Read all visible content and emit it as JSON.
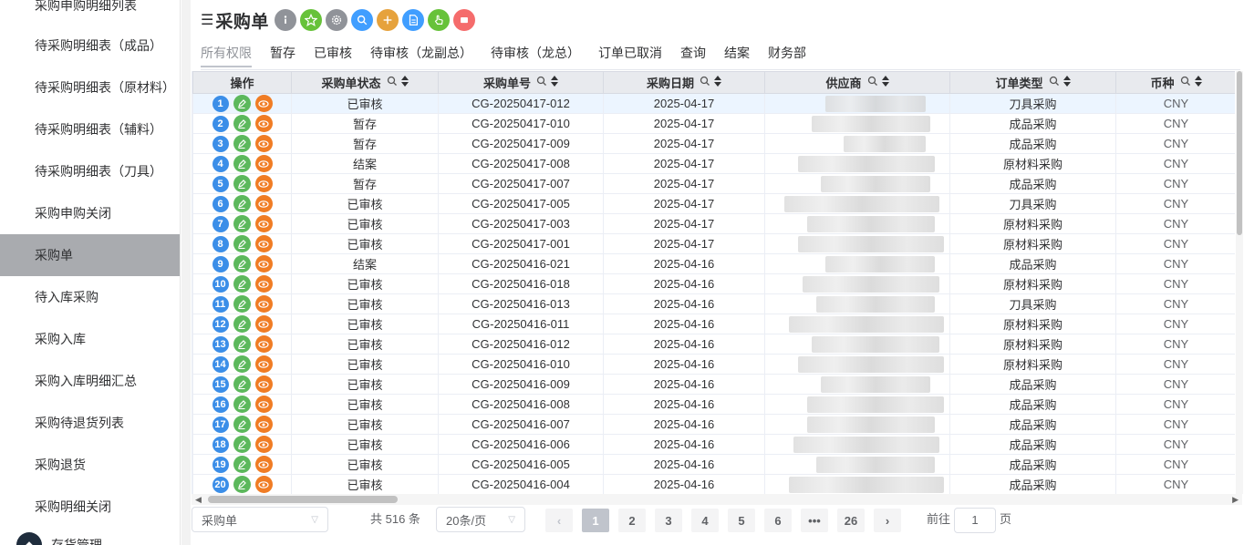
{
  "sidebar": {
    "items": [
      {
        "label": "采购申购明细列表"
      },
      {
        "label": "待采购明细表（成品）"
      },
      {
        "label": "待采购明细表（原材料）"
      },
      {
        "label": "待采购明细表（辅料）"
      },
      {
        "label": "待采购明细表（刀具）"
      },
      {
        "label": "采购申购关闭"
      },
      {
        "label": "采购单"
      },
      {
        "label": "待入库采购"
      },
      {
        "label": "采购入库"
      },
      {
        "label": "采购入库明细汇总"
      },
      {
        "label": "采购待退货列表"
      },
      {
        "label": "采购退货"
      },
      {
        "label": "采购明细关闭"
      }
    ],
    "active_index": 6,
    "bottom_group": {
      "label": "存货管理"
    }
  },
  "header": {
    "title": "采购单",
    "menu_icon": "☰",
    "toolbar": [
      {
        "icon": "info-icon",
        "color": "#909399"
      },
      {
        "icon": "star-icon",
        "color": "#67c23a"
      },
      {
        "icon": "settings-icon",
        "color": "#909399"
      },
      {
        "icon": "search-icon",
        "color": "#409eff"
      },
      {
        "icon": "plus-icon",
        "color": "#e6a23c"
      },
      {
        "icon": "document-icon",
        "color": "#409eff"
      },
      {
        "icon": "hand-icon",
        "color": "#67c23a"
      },
      {
        "icon": "delete-icon",
        "color": "#f56c6c"
      }
    ]
  },
  "tabs": [
    {
      "label": "所有权限"
    },
    {
      "label": "暂存"
    },
    {
      "label": "已审核"
    },
    {
      "label": "待审核（龙副总）"
    },
    {
      "label": "待审核（龙总）"
    },
    {
      "label": "订单已取消"
    },
    {
      "label": "查询"
    },
    {
      "label": "结案"
    },
    {
      "label": "财务部"
    }
  ],
  "table": {
    "columns": [
      {
        "label": "操作"
      },
      {
        "label": "采购单状态"
      },
      {
        "label": "采购单号"
      },
      {
        "label": "采购日期"
      },
      {
        "label": "供应商"
      },
      {
        "label": "订单类型"
      },
      {
        "label": "币种"
      }
    ],
    "rows": [
      {
        "no": "1",
        "status": "已审核",
        "order_no": "CG-20250417-012",
        "date": "2025-04-17",
        "type": "刀具采购",
        "currency": "CNY"
      },
      {
        "no": "2",
        "status": "暂存",
        "order_no": "CG-20250417-010",
        "date": "2025-04-17",
        "type": "成品采购",
        "currency": "CNY"
      },
      {
        "no": "3",
        "status": "暂存",
        "order_no": "CG-20250417-009",
        "date": "2025-04-17",
        "type": "成品采购",
        "currency": "CNY"
      },
      {
        "no": "4",
        "status": "结案",
        "order_no": "CG-20250417-008",
        "date": "2025-04-17",
        "type": "原材料采购",
        "currency": "CNY"
      },
      {
        "no": "5",
        "status": "暂存",
        "order_no": "CG-20250417-007",
        "date": "2025-04-17",
        "type": "成品采购",
        "currency": "CNY"
      },
      {
        "no": "6",
        "status": "已审核",
        "order_no": "CG-20250417-005",
        "date": "2025-04-17",
        "type": "刀具采购",
        "currency": "CNY"
      },
      {
        "no": "7",
        "status": "已审核",
        "order_no": "CG-20250417-003",
        "date": "2025-04-17",
        "type": "原材料采购",
        "currency": "CNY"
      },
      {
        "no": "8",
        "status": "已审核",
        "order_no": "CG-20250417-001",
        "date": "2025-04-17",
        "type": "原材料采购",
        "currency": "CNY"
      },
      {
        "no": "9",
        "status": "结案",
        "order_no": "CG-20250416-021",
        "date": "2025-04-16",
        "type": "成品采购",
        "currency": "CNY"
      },
      {
        "no": "10",
        "status": "已审核",
        "order_no": "CG-20250416-018",
        "date": "2025-04-16",
        "type": "原材料采购",
        "currency": "CNY"
      },
      {
        "no": "11",
        "status": "已审核",
        "order_no": "CG-20250416-013",
        "date": "2025-04-16",
        "type": "刀具采购",
        "currency": "CNY"
      },
      {
        "no": "12",
        "status": "已审核",
        "order_no": "CG-20250416-011",
        "date": "2025-04-16",
        "type": "原材料采购",
        "currency": "CNY"
      },
      {
        "no": "13",
        "status": "已审核",
        "order_no": "CG-20250416-012",
        "date": "2025-04-16",
        "type": "原材料采购",
        "currency": "CNY"
      },
      {
        "no": "14",
        "status": "已审核",
        "order_no": "CG-20250416-010",
        "date": "2025-04-16",
        "type": "原材料采购",
        "currency": "CNY"
      },
      {
        "no": "15",
        "status": "已审核",
        "order_no": "CG-20250416-009",
        "date": "2025-04-16",
        "type": "成品采购",
        "currency": "CNY"
      },
      {
        "no": "16",
        "status": "已审核",
        "order_no": "CG-20250416-008",
        "date": "2025-04-16",
        "type": "成品采购",
        "currency": "CNY"
      },
      {
        "no": "17",
        "status": "已审核",
        "order_no": "CG-20250416-007",
        "date": "2025-04-16",
        "type": "成品采购",
        "currency": "CNY"
      },
      {
        "no": "18",
        "status": "已审核",
        "order_no": "CG-20250416-006",
        "date": "2025-04-16",
        "type": "成品采购",
        "currency": "CNY"
      },
      {
        "no": "19",
        "status": "已审核",
        "order_no": "CG-20250416-005",
        "date": "2025-04-16",
        "type": "成品采购",
        "currency": "CNY"
      },
      {
        "no": "20",
        "status": "已审核",
        "order_no": "CG-20250416-004",
        "date": "2025-04-16",
        "type": "成品采购",
        "currency": "CNY"
      }
    ],
    "selected_row": 0
  },
  "footer": {
    "view_select": "采购单",
    "total_text": "共 516 条",
    "page_size": "20条/页",
    "pages": [
      "1",
      "2",
      "3",
      "4",
      "5",
      "6",
      "•••",
      "26"
    ],
    "current_page": "1",
    "goto_label": "前往",
    "goto_value": "1",
    "goto_suffix": "页"
  }
}
